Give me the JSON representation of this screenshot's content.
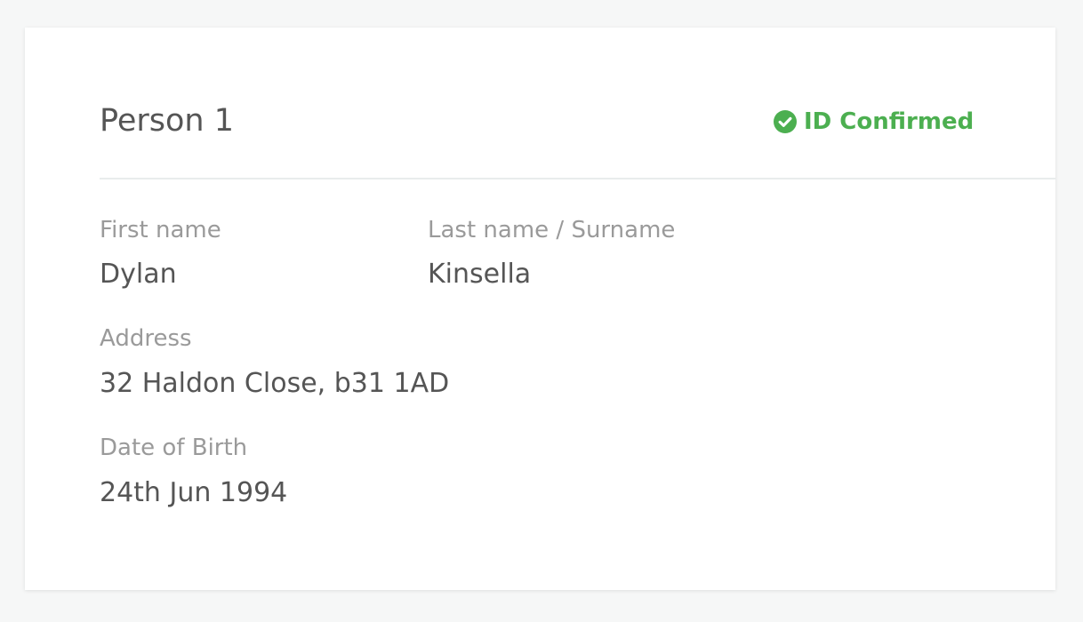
{
  "person": {
    "title": "Person 1",
    "status": {
      "label": "ID Confirmed",
      "icon": "check-circle-icon",
      "color": "#4caf50"
    },
    "fields": {
      "first_name": {
        "label": "First name",
        "value": "Dylan"
      },
      "last_name": {
        "label": "Last name / Surname",
        "value": "Kinsella"
      },
      "address": {
        "label": "Address",
        "value": "32 Haldon Close, b31 1AD"
      },
      "dob": {
        "label": "Date of Birth",
        "value": "24th Jun 1994"
      }
    }
  },
  "colors": {
    "background": "#f6f7f7",
    "card": "#ffffff",
    "divider": "#e9ecec",
    "label": "#9a9a9a",
    "value": "#555555",
    "success": "#4caf50"
  }
}
